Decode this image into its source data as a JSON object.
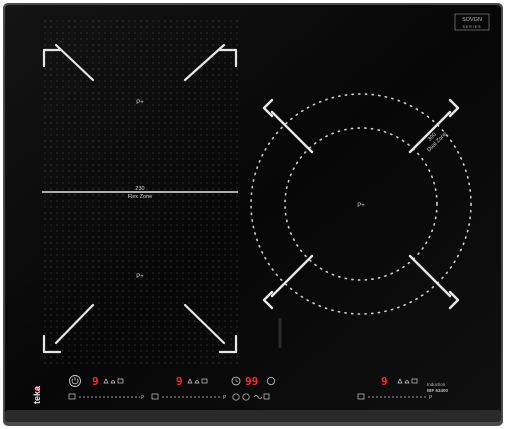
{
  "brand": {
    "logo_text": "teka"
  },
  "badge": {
    "line1": "SOVGN",
    "line2": "SERIES"
  },
  "zones": {
    "flex_upper_power": "P+",
    "flex_lower_power": "P+",
    "flex_size": "230",
    "flex_label": "Flex Zone",
    "dual_size": "300",
    "dual_label": "Dual Zone",
    "dual_power": "P+"
  },
  "model": {
    "line1": "Induction",
    "line2": "IBF 63400"
  },
  "display": {
    "zone1_level": "9",
    "zone2_level": "9",
    "timer_value": "99",
    "zone4_level": "9"
  },
  "colors": {
    "glass": "#0b0b0b",
    "frame": "#3a3a3a",
    "marking": "#e6e6e6",
    "led": "#ff2a2a"
  }
}
